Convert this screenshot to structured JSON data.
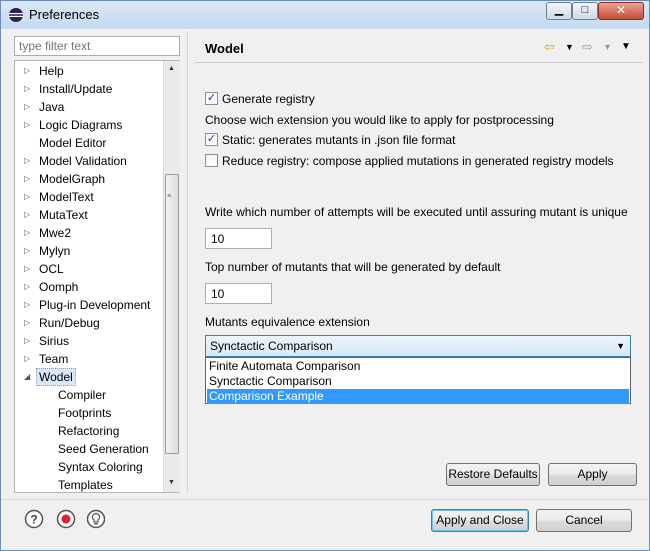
{
  "window": {
    "title": "Preferences",
    "controls": {
      "minimize": "",
      "maximize": "",
      "close": ""
    }
  },
  "filter": {
    "placeholder": "type filter text"
  },
  "tree": {
    "items": [
      {
        "label": "Help",
        "twisty": "▷"
      },
      {
        "label": "Install/Update",
        "twisty": "▷"
      },
      {
        "label": "Java",
        "twisty": "▷"
      },
      {
        "label": "Logic Diagrams",
        "twisty": "▷"
      },
      {
        "label": "Model Editor",
        "twisty": ""
      },
      {
        "label": "Model Validation",
        "twisty": "▷"
      },
      {
        "label": "ModelGraph",
        "twisty": "▷"
      },
      {
        "label": "ModelText",
        "twisty": "▷"
      },
      {
        "label": "MutaText",
        "twisty": "▷"
      },
      {
        "label": "Mwe2",
        "twisty": "▷"
      },
      {
        "label": "Mylyn",
        "twisty": "▷"
      },
      {
        "label": "OCL",
        "twisty": "▷"
      },
      {
        "label": "Oomph",
        "twisty": "▷"
      },
      {
        "label": "Plug-in Development",
        "twisty": "▷"
      },
      {
        "label": "Run/Debug",
        "twisty": "▷"
      },
      {
        "label": "Sirius",
        "twisty": "▷"
      },
      {
        "label": "Team",
        "twisty": "▷"
      },
      {
        "label": "Wodel",
        "twisty": "◢",
        "selected": true
      },
      {
        "label": "Compiler",
        "child": true
      },
      {
        "label": "Footprints",
        "child": true
      },
      {
        "label": "Refactoring",
        "child": true
      },
      {
        "label": "Seed Generation",
        "child": true
      },
      {
        "label": "Syntax Coloring",
        "child": true
      },
      {
        "label": "Templates",
        "child": true
      }
    ]
  },
  "page": {
    "title": "Wodel",
    "generate_registry": {
      "label": "Generate registry",
      "checked": true
    },
    "extension_prompt": "Choose wich extension you would like to apply for postprocessing",
    "static_option": {
      "label": "Static: generates mutants in .json file format",
      "checked": true
    },
    "reduce_option": {
      "label": "Reduce registry: compose applied mutations in generated registry models",
      "checked": false
    },
    "attempts_label": "Write which number of attempts will be executed until assuring mutant is unique",
    "attempts_value": "10",
    "top_mutants_label": "Top number of mutants that will be generated by default",
    "top_mutants_value": "10",
    "equivalence_label": "Mutants equivalence extension",
    "equivalence_selected": "Synctactic Comparison",
    "equivalence_options": [
      "Finite Automata Comparison",
      "Synctactic Comparison",
      "Comparison Example"
    ],
    "highlighted_option": "Comparison Example",
    "restore_defaults": "Restore Defaults",
    "apply": "Apply"
  },
  "footer": {
    "apply_and_close": "Apply and Close",
    "cancel": "Cancel",
    "icons": [
      "help-icon",
      "record-icon",
      "tip-icon"
    ]
  },
  "colors": {
    "selection": "#3399ff",
    "accent": "#3c7fb1",
    "nav_arrow": "#e0a020"
  }
}
